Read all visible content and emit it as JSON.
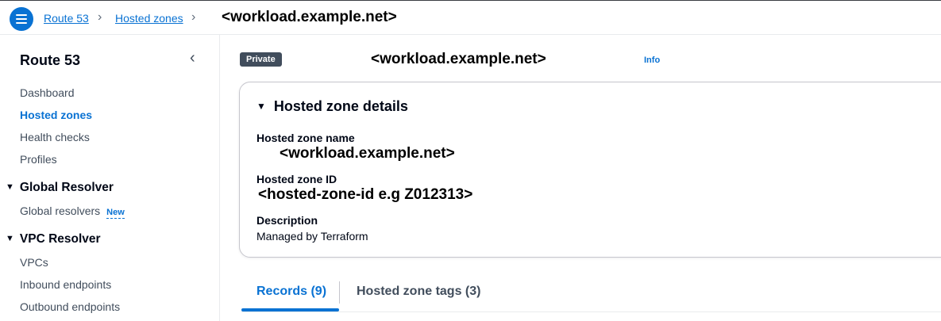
{
  "breadcrumb": {
    "items": [
      "Route 53",
      "Hosted zones"
    ],
    "current": "<workload.example.net>"
  },
  "sidebar": {
    "title": "Route 53",
    "items": [
      {
        "label": "Dashboard",
        "active": false
      },
      {
        "label": "Hosted zones",
        "active": true
      },
      {
        "label": "Health checks",
        "active": false
      },
      {
        "label": "Profiles",
        "active": false
      }
    ],
    "groups": [
      {
        "label": "Global Resolver",
        "items": [
          {
            "label": "Global resolvers",
            "badge": "New"
          }
        ]
      },
      {
        "label": "VPC Resolver",
        "items": [
          {
            "label": "VPCs"
          },
          {
            "label": "Inbound endpoints"
          },
          {
            "label": "Outbound endpoints"
          }
        ]
      }
    ]
  },
  "header": {
    "badge": "Private",
    "zone_name": "<workload.example.net>",
    "info": "Info"
  },
  "details": {
    "title": "Hosted zone details",
    "name_label": "Hosted zone name",
    "name_value": "<workload.example.net>",
    "id_label": "Hosted zone ID",
    "id_value": "<hosted-zone-id e.g Z012313>",
    "description_label": "Description",
    "description_value": "Managed by Terraform"
  },
  "tabs": [
    {
      "label": "Records (9)",
      "active": true
    },
    {
      "label": "Hosted zone tags (3)",
      "active": false
    }
  ],
  "colors": {
    "accent": "#0972d3",
    "badge_bg": "#414d5c",
    "text": "#000716"
  }
}
